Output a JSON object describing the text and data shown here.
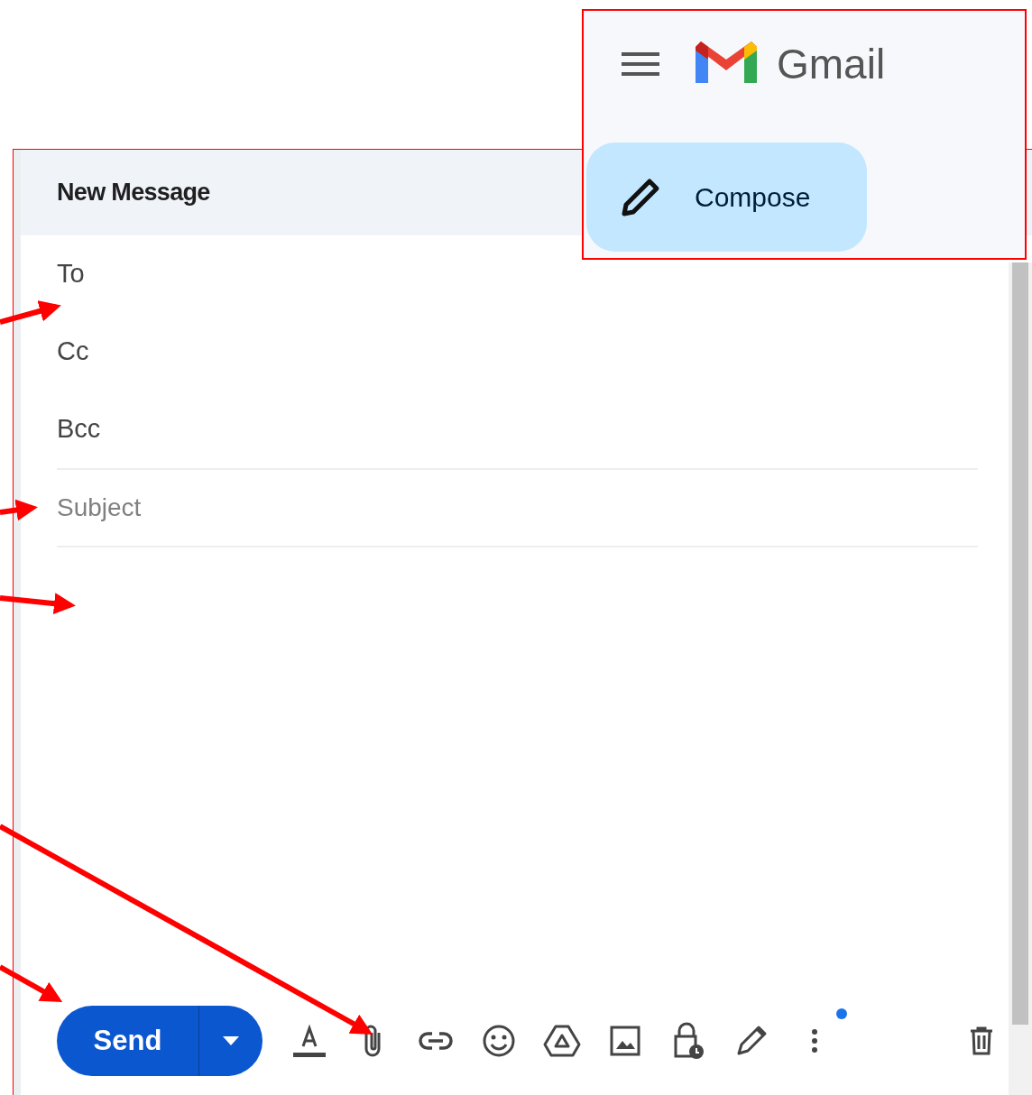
{
  "compose": {
    "title": "New Message",
    "recipients": [
      {
        "label": "To"
      },
      {
        "label": "Cc"
      },
      {
        "label": "Bcc"
      }
    ],
    "subject": {
      "placeholder": "Subject"
    },
    "send_button": "Send",
    "toolbar": [
      {
        "kind": "format"
      },
      {
        "kind": "attach"
      },
      {
        "kind": "link"
      },
      {
        "kind": "emoji"
      },
      {
        "kind": "drive"
      },
      {
        "kind": "photo"
      },
      {
        "kind": "confidential"
      },
      {
        "kind": "signature"
      },
      {
        "kind": "more",
        "notification": true
      }
    ]
  },
  "inset": {
    "app_name": "Gmail",
    "compose_button": "Compose"
  }
}
